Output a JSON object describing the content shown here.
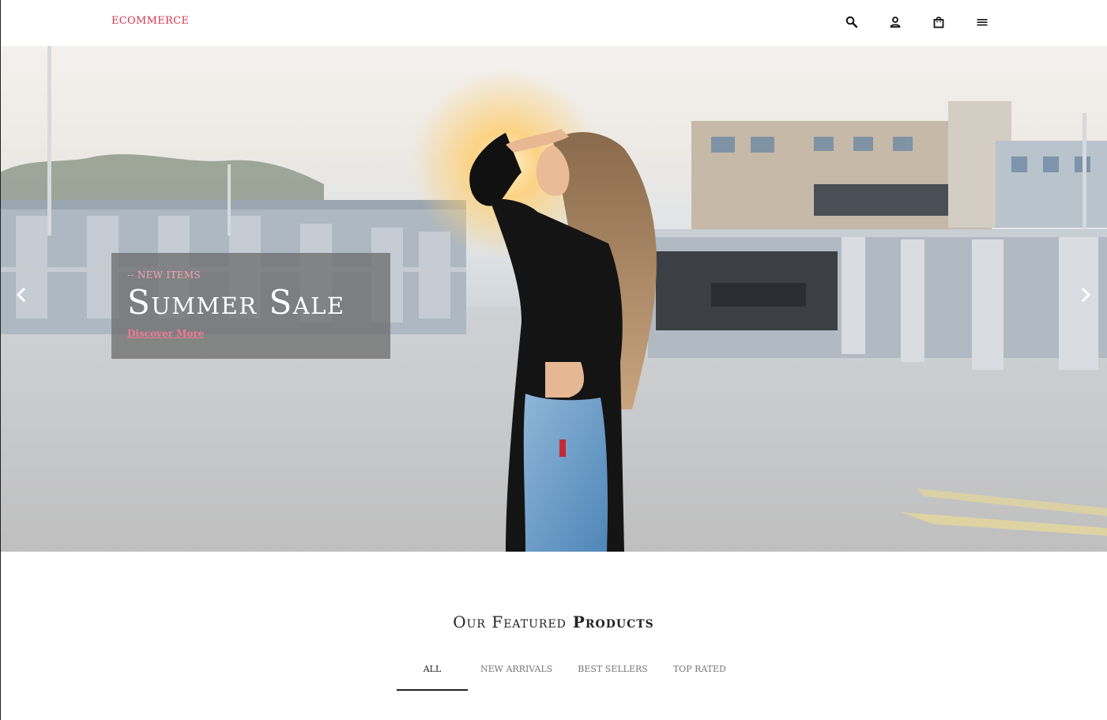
{
  "header": {
    "logo": "ECOMMERCE",
    "icons": [
      "search-icon",
      "user-icon",
      "shopping-bag-icon",
      "menu-icon"
    ]
  },
  "hero": {
    "kicker": "-- NEW ITEMS",
    "title": "Summer Sale",
    "link": "Discover More",
    "prev_icon": "chevron-left-icon",
    "next_icon": "chevron-right-icon"
  },
  "featured": {
    "title_light": "Our Featured",
    "title_bold": "Products",
    "tabs": [
      {
        "label": "ALL",
        "active": true
      },
      {
        "label": "NEW ARRIVALS",
        "active": false
      },
      {
        "label": "BEST SELLERS",
        "active": false
      },
      {
        "label": "TOP RATED",
        "active": false
      }
    ]
  },
  "colors": {
    "brand": "#d0364e",
    "link": "#f07a95",
    "kicker": "#f3a7b4"
  }
}
